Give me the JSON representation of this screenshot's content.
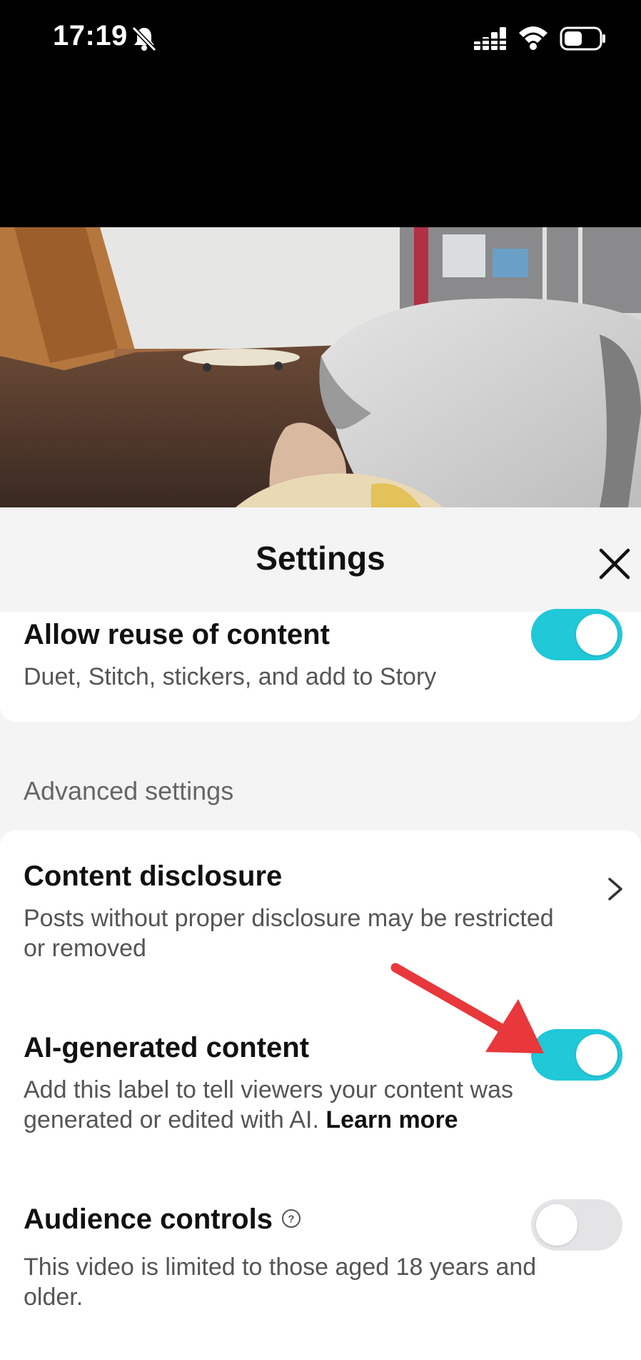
{
  "status_bar": {
    "time": "17:19"
  },
  "settings": {
    "title": "Settings",
    "reuse": {
      "title": "Allow reuse of content",
      "description": "Duet, Stitch, stickers, and add to Story",
      "enabled": true
    },
    "advanced_label": "Advanced settings",
    "disclosure": {
      "title": "Content disclosure",
      "description_line1": "Posts without proper disclosure may be restricted",
      "description_line2": "or removed"
    },
    "ai_content": {
      "title": "AI-generated content",
      "description_line1": "Add this label to tell viewers your content was",
      "description_line2": "generated or edited with AI.",
      "learn_more": "Learn more",
      "enabled": true
    },
    "audience": {
      "title": "Audience controls",
      "description_line1": "This video is limited to those aged 18 years and",
      "description_line2": "older.",
      "enabled": false
    }
  },
  "colors": {
    "toggle_on": "#20c8d8",
    "toggle_off": "#e4e4e6",
    "annotation_arrow": "#e8383b"
  }
}
